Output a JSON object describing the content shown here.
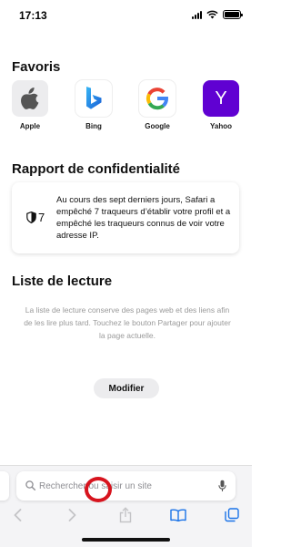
{
  "status": {
    "time": "17:13"
  },
  "favorites": {
    "title": "Favoris",
    "items": [
      {
        "label": "Apple",
        "icon": "apple-logo-icon",
        "bg": "#ececee"
      },
      {
        "label": "Bing",
        "icon": "bing-logo-icon",
        "bg": "#ffffff"
      },
      {
        "label": "Google",
        "icon": "google-logo-icon",
        "bg": "#ffffff"
      },
      {
        "label": "Yahoo",
        "icon": "yahoo-logo-icon",
        "bg": "#6001d2",
        "glyph": "Y"
      }
    ]
  },
  "privacy": {
    "title": "Rapport de confidentialité",
    "count": "7",
    "icon": "shield-icon",
    "text": "Au cours des sept derniers jours, Safari a empêché 7 traqueurs d’établir votre profil et a empêché les traqueurs connus de voir votre adresse IP."
  },
  "reading_list": {
    "title": "Liste de lecture",
    "text": "La liste de lecture conserve des pages web et des liens afin de les lire plus tard. Touchez le bouton Partager pour ajouter la page actuelle.",
    "edit_label": "Modifier"
  },
  "address_bar": {
    "placeholder": "Rechercher ou saisir un site",
    "icon_left": "search-icon",
    "icon_right": "microphone-icon"
  },
  "toolbar": {
    "items": [
      "back-icon",
      "forward-icon",
      "share-icon",
      "bookmarks-icon",
      "tabs-icon"
    ]
  },
  "colors": {
    "accent": "#1a73e8",
    "tap_marker": "#d7141e",
    "yahoo": "#6001d2"
  }
}
